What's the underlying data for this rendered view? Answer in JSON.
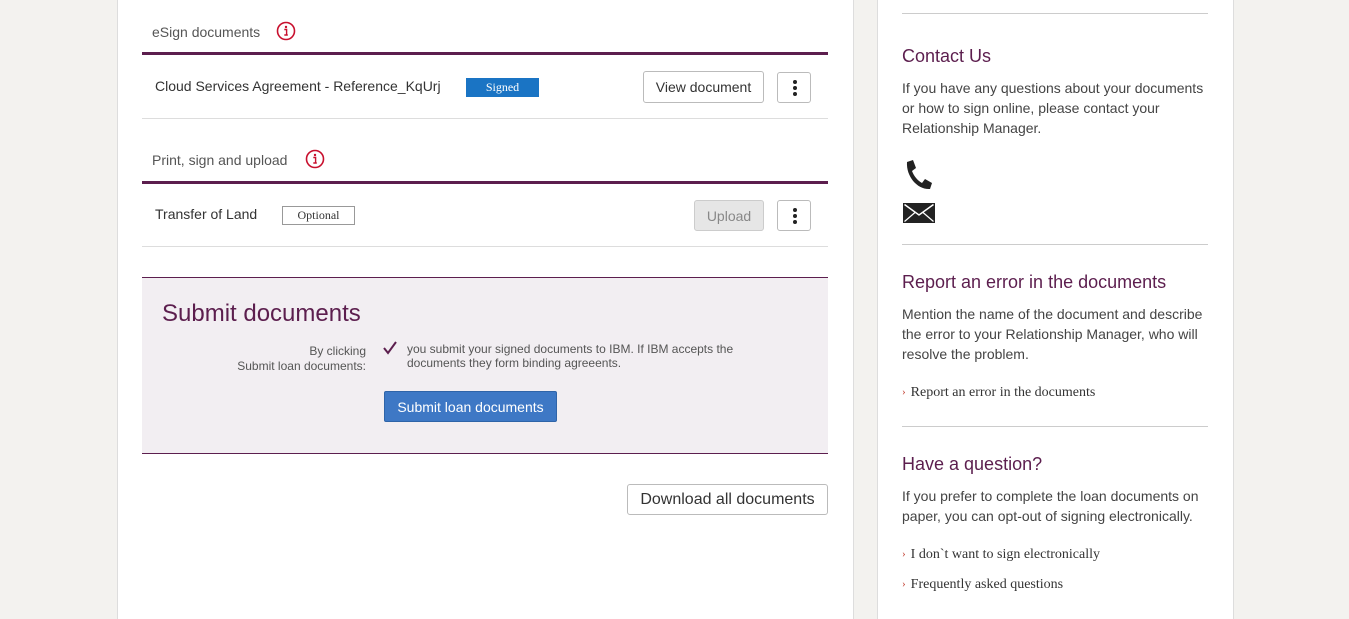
{
  "esign": {
    "title": "eSign documents",
    "doc_name": "Cloud Services Agreement - Reference_KqUrj",
    "status": "Signed",
    "view_label": "View document"
  },
  "print": {
    "title": "Print, sign and upload",
    "doc_name": "Transfer of Land",
    "status": "Optional",
    "upload_label": "Upload"
  },
  "submit": {
    "title": "Submit documents",
    "by_clicking_1": "By clicking",
    "by_clicking_2": "Submit loan documents:",
    "consent_text": "you submit your signed documents to IBM. If IBM accepts the documents they form binding agreeents.",
    "button_label": "Submit loan documents"
  },
  "download_label": "Download all documents",
  "sidebar": {
    "contact": {
      "heading": "Contact Us",
      "text": "If you have any questions about your documents or how to sign online, please contact your Relationship Manager.",
      "phone_icon": "phone-icon",
      "email_icon": "envelope-icon"
    },
    "report": {
      "heading": "Report an error in the documents",
      "text": "Mention the name of the document and describe the error to your Relationship Manager, who will resolve the problem.",
      "link": "Report an error in the documents"
    },
    "question": {
      "heading": "Have a question?",
      "text": "If you prefer to complete the loan documents on paper, you can opt-out of signing electronically.",
      "link_1": "I don`t want to sign electronically",
      "link_2": "Frequently asked questions"
    }
  },
  "colors": {
    "accent": "#5c1e4e",
    "signed_badge": "#1a74c4",
    "primary_button": "#3e78c5",
    "info_icon": "#c8102e"
  }
}
